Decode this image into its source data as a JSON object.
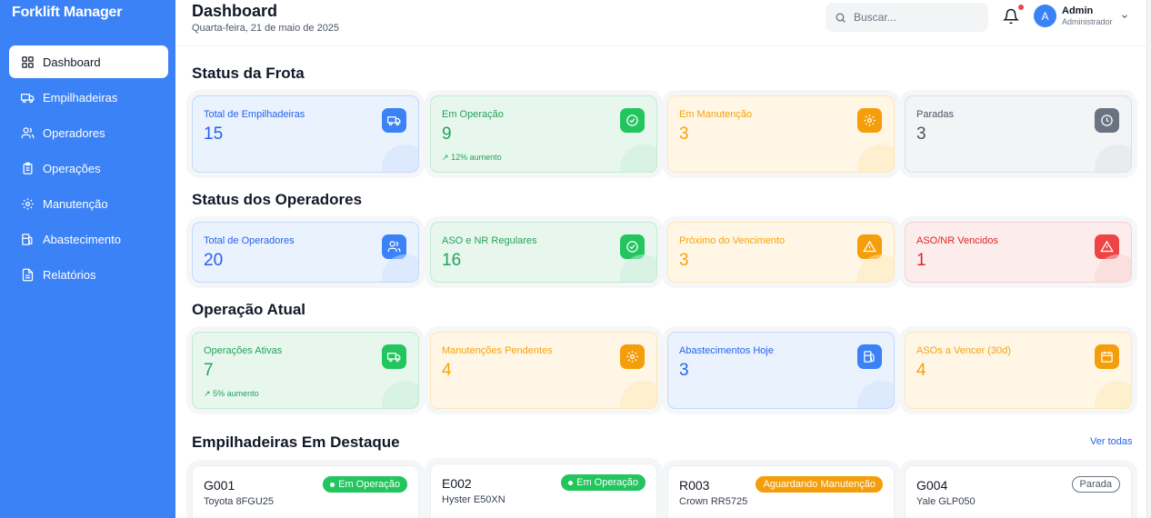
{
  "app": {
    "brand": "Forklift Manager"
  },
  "sidebar": {
    "items": [
      {
        "label": "Dashboard",
        "icon": "dashboard-icon"
      },
      {
        "label": "Empilhadeiras",
        "icon": "truck-icon"
      },
      {
        "label": "Operadores",
        "icon": "users-icon"
      },
      {
        "label": "Operações",
        "icon": "clipboard-icon"
      },
      {
        "label": "Manutenção",
        "icon": "gear-icon"
      },
      {
        "label": "Abastecimento",
        "icon": "fuel-icon"
      },
      {
        "label": "Relatórios",
        "icon": "file-icon"
      }
    ]
  },
  "header": {
    "title": "Dashboard",
    "date": "Quarta-feira, 21 de maio de 2025",
    "search_placeholder": "Buscar...",
    "user_name": "Admin",
    "user_role": "Administrador",
    "avatar_initial": "A"
  },
  "fleet": {
    "title": "Status da Frota",
    "cards": [
      {
        "label": "Total de Empilhadeiras",
        "value": "15",
        "color": "blue",
        "icon": "truck-icon"
      },
      {
        "label": "Em Operação",
        "value": "9",
        "trend": "12% aumento",
        "color": "green",
        "icon": "check-circle-icon"
      },
      {
        "label": "Em Manutenção",
        "value": "3",
        "color": "orange",
        "icon": "gear-icon"
      },
      {
        "label": "Paradas",
        "value": "3",
        "color": "gray",
        "icon": "clock-icon"
      }
    ]
  },
  "operators": {
    "title": "Status dos Operadores",
    "cards": [
      {
        "label": "Total de Operadores",
        "value": "20",
        "color": "blue",
        "icon": "users-icon"
      },
      {
        "label": "ASO e NR Regulares",
        "value": "16",
        "color": "green",
        "icon": "check-circle-icon"
      },
      {
        "label": "Próximo do Vencimento",
        "value": "3",
        "color": "orange",
        "icon": "warning-icon"
      },
      {
        "label": "ASO/NR Vencidos",
        "value": "1",
        "color": "red",
        "icon": "warning-icon"
      }
    ]
  },
  "current": {
    "title": "Operação Atual",
    "cards": [
      {
        "label": "Operações Ativas",
        "value": "7",
        "trend": "5% aumento",
        "color": "green",
        "icon": "truck-icon"
      },
      {
        "label": "Manutenções Pendentes",
        "value": "4",
        "color": "orange",
        "icon": "gear-icon"
      },
      {
        "label": "Abastecimentos Hoje",
        "value": "3",
        "color": "blue",
        "icon": "fuel-icon"
      },
      {
        "label": "ASOs a Vencer (30d)",
        "value": "4",
        "color": "orange",
        "icon": "calendar-icon"
      }
    ]
  },
  "featured": {
    "title": "Empilhadeiras Em Destaque",
    "view_all": "Ver todas",
    "items": [
      {
        "code": "G001",
        "model": "Toyota 8FGU25",
        "status": "Em Operação",
        "status_type": "green"
      },
      {
        "code": "E002",
        "model": "Hyster E50XN",
        "status": "Em Operação",
        "status_type": "green"
      },
      {
        "code": "R003",
        "model": "Crown RR5725",
        "status": "Aguardando Manutenção",
        "status_type": "orange"
      },
      {
        "code": "G004",
        "model": "Yale GLP050",
        "status": "Parada",
        "status_type": "outline"
      }
    ]
  }
}
